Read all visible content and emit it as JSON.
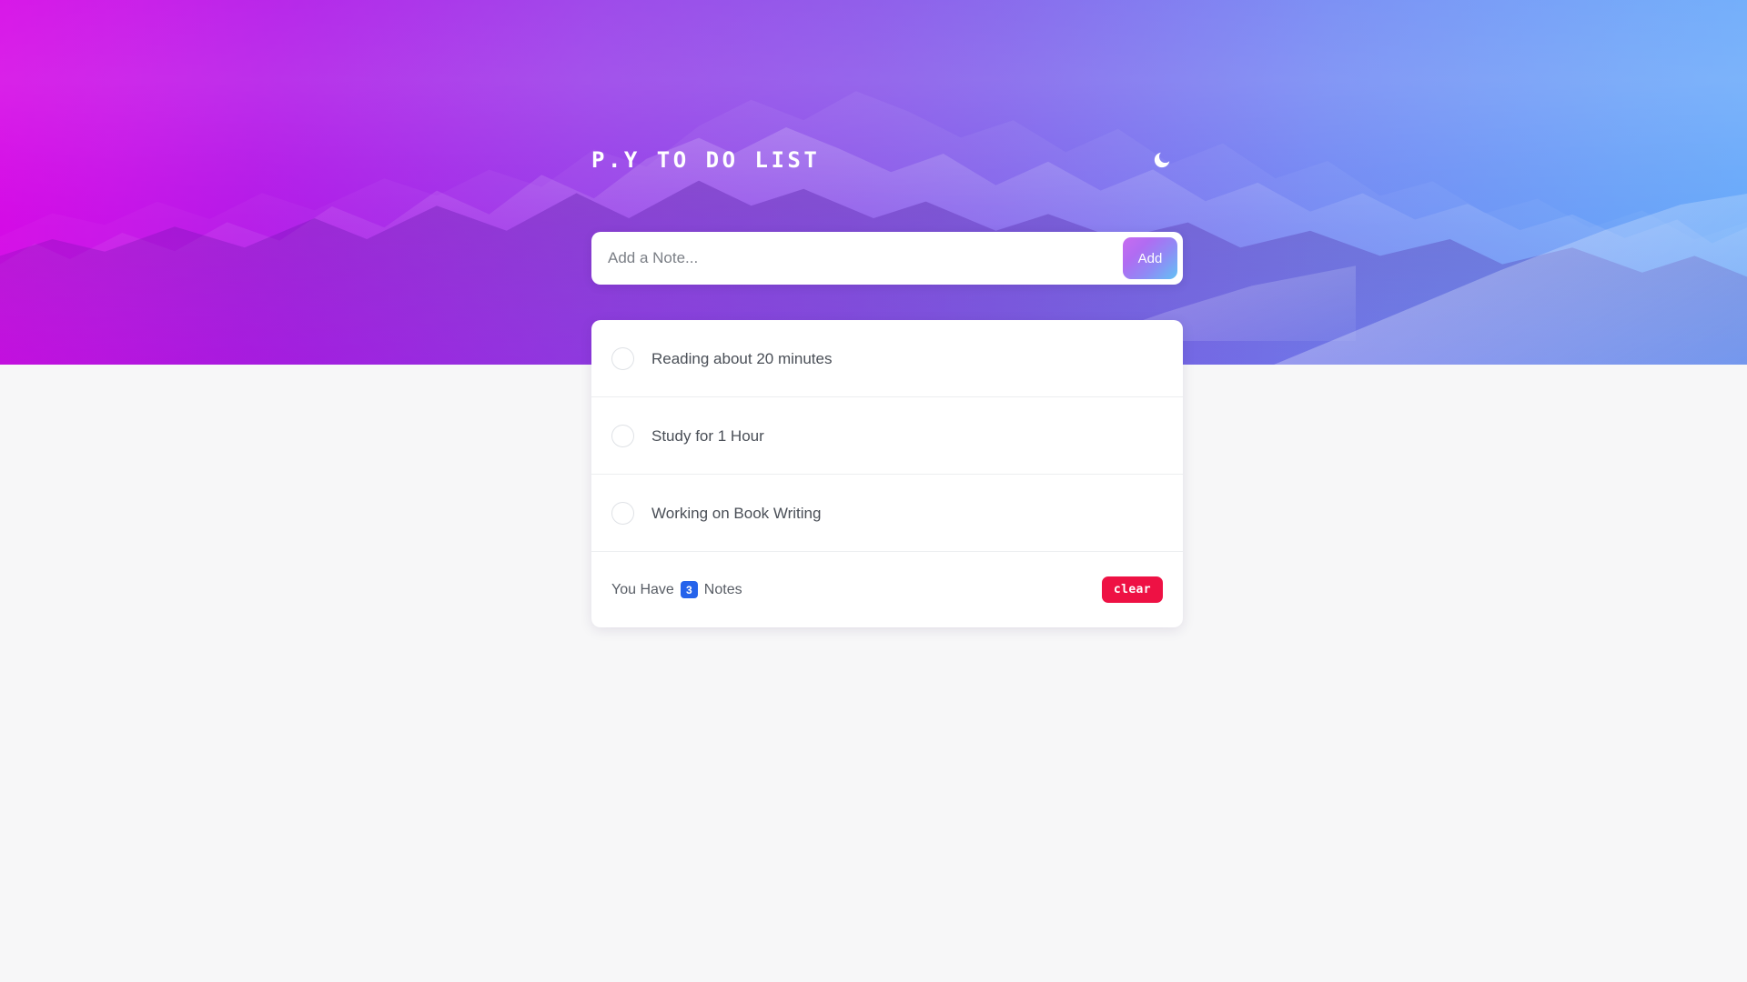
{
  "header": {
    "title": "P.Y TO DO LIST",
    "theme_toggle_icon": "moon-icon"
  },
  "compose": {
    "placeholder": "Add a Note...",
    "value": "",
    "add_label": "Add"
  },
  "todos": [
    {
      "label": "Reading about 20 minutes",
      "done": false
    },
    {
      "label": "Study for 1 Hour",
      "done": false
    },
    {
      "label": "Working on Book Writing",
      "done": false
    }
  ],
  "footer": {
    "count_prefix": "You Have",
    "count": "3",
    "count_suffix": "Notes",
    "clear_label": "clear"
  },
  "colors": {
    "badge_blue": "#2563eb",
    "clear_red": "#ee1144",
    "add_gradient_start": "#c86bf0",
    "add_gradient_end": "#63c2f5",
    "page_background": "#f7f7f8",
    "card_white": "#ffffff",
    "title_white": "#ffffff"
  }
}
